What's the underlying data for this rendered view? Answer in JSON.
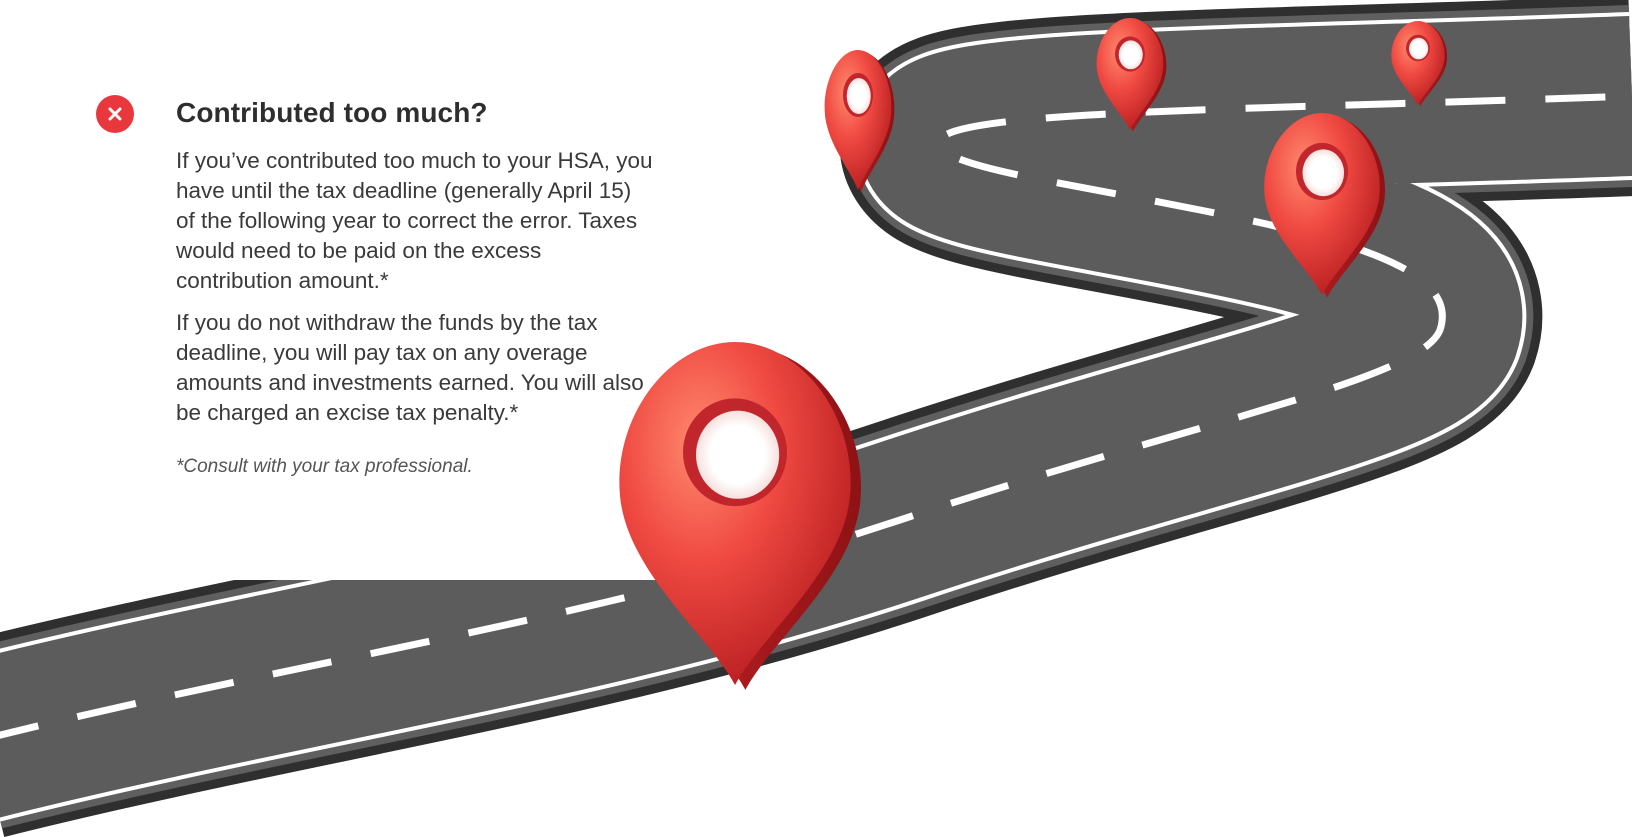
{
  "section": {
    "heading": "Contributed too much?",
    "paragraphs": [
      "If you’ve contributed too much to your HSA, you have until the tax deadline (generally April 15) of the following year to correct the error. Taxes would need to be paid on the excess contribution amount.*",
      "If you do not withdraw the funds by the tax deadline, you will pay tax on any overage amounts and investments earned. You will also be charged an excise tax penalty.*"
    ],
    "footnote": "*Consult with your tax professional."
  },
  "icons": {
    "status": "close-x-icon",
    "markers": "map-pin-icon",
    "road": "winding-road"
  },
  "colors": {
    "accent": "#e8383e",
    "pin": "#f04a42",
    "road": "#5a5a5a",
    "road_edge": "#3a3a3a",
    "lane_marking": "#ffffff",
    "heading": "#2e2e2e",
    "body_text": "#3a3a3a"
  }
}
